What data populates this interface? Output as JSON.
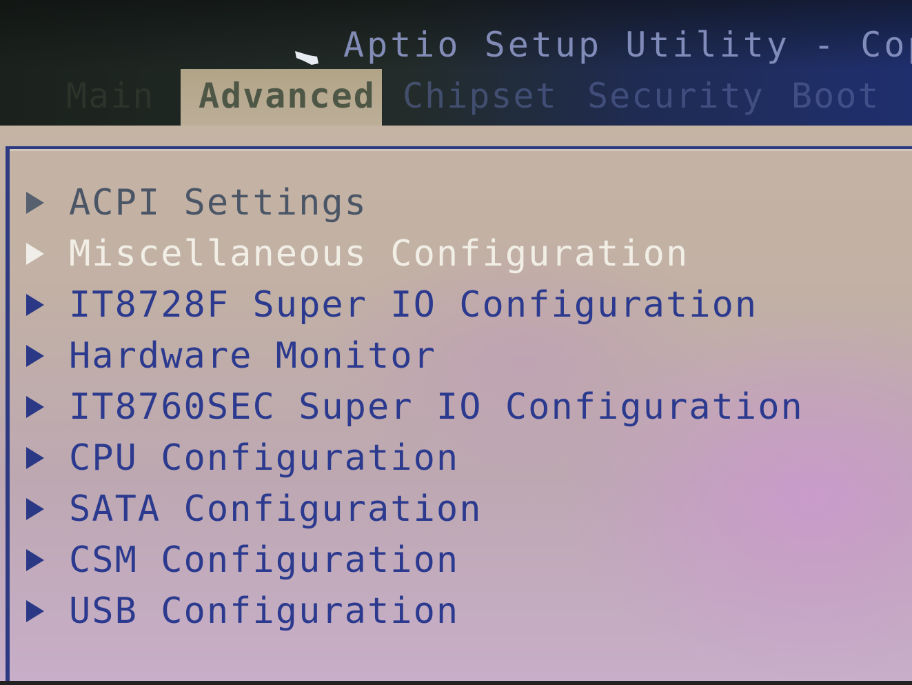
{
  "header": {
    "title": "Aptio Setup Utility - Copyri"
  },
  "tabs": [
    {
      "label": "Main",
      "active": false
    },
    {
      "label": "Advanced",
      "active": true
    },
    {
      "label": "Chipset",
      "active": false
    },
    {
      "label": "Security",
      "active": false
    },
    {
      "label": "Boot",
      "active": false
    }
  ],
  "menu": {
    "selected_index": 1,
    "items": [
      {
        "label": "ACPI Settings"
      },
      {
        "label": "Miscellaneous Configuration"
      },
      {
        "label": "IT8728F Super IO Configuration"
      },
      {
        "label": "Hardware Monitor"
      },
      {
        "label": "IT8760SEC Super IO Configuration"
      },
      {
        "label": "CPU Configuration"
      },
      {
        "label": "SATA Configuration"
      },
      {
        "label": "CSM Configuration"
      },
      {
        "label": "USB Configuration"
      }
    ]
  },
  "colors": {
    "text_normal": "#2b3a8e",
    "text_selected": "#f1eee6",
    "header_blue": "#1f2f6e",
    "panel_border": "#2d3a82"
  },
  "icons": {
    "submenu": "triangle-right-icon",
    "cursor": "mouse-pointer-icon"
  }
}
